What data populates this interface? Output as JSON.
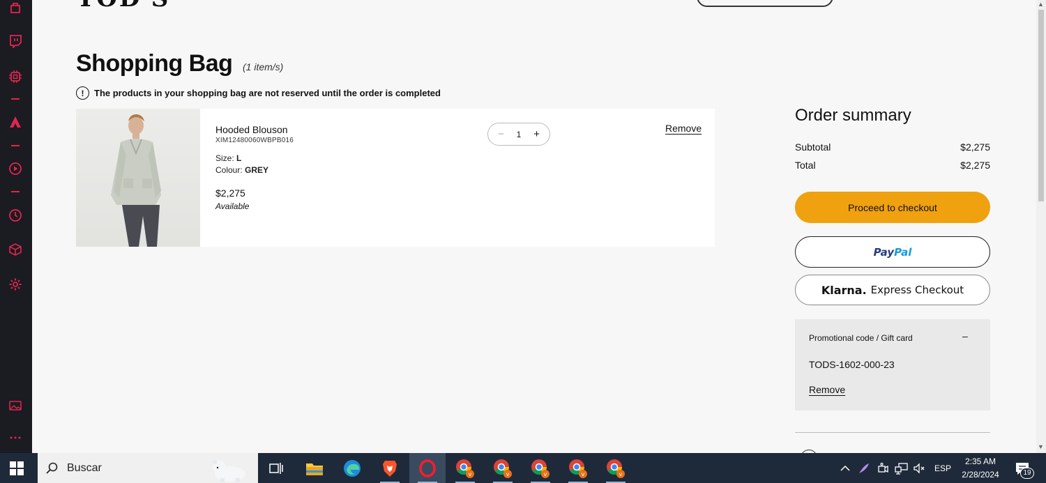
{
  "header": {
    "logo": "TOD'S"
  },
  "cart": {
    "title": "Shopping Bag",
    "count": "(1 item/s)",
    "notice": "The products in your shopping bag are not reserved until the order is completed",
    "item": {
      "name": "Hooded Blouson",
      "sku": "XIM12480060WBPB016",
      "size_label": "Size:",
      "size": "L",
      "colour_label": "Colour:",
      "colour": "GREY",
      "price": "$2,275",
      "availability": "Available",
      "quantity": "1",
      "minus": "−",
      "plus": "+",
      "remove": "Remove"
    }
  },
  "summary": {
    "title": "Order summary",
    "subtotal_label": "Subtotal",
    "subtotal": "$2,275",
    "total_label": "Total",
    "total": "$2,275",
    "checkout": "Proceed to checkout",
    "paypal_a": "Pay",
    "paypal_b": "Pal",
    "klarna_logo": "Klarna.",
    "klarna_text": "Express Checkout",
    "promo_label": "Promotional code / Gift card",
    "promo_toggle": "–",
    "promo_code": "TODS-1602-000-23",
    "promo_remove": "Remove"
  },
  "colors": {
    "checkout": "#f0a10f",
    "sidebar": "#1b1b22",
    "sidebar_icon": "#e0264e",
    "taskbar": "#1e2a3a"
  },
  "sidebar_icons": [
    "bag-icon",
    "twitch-icon",
    "chip-icon",
    "aria-icon",
    "play-icon",
    "history-icon",
    "box-icon",
    "settings-icon",
    "gallery-icon",
    "more-icon"
  ],
  "taskbar": {
    "search_text": "Buscar",
    "apps": [
      "task-view-icon",
      "file-explorer-icon",
      "edge-icon",
      "brave-icon",
      "opera-icon",
      "chrome-icon",
      "chrome-icon",
      "chrome-icon",
      "chrome-icon",
      "chrome-icon"
    ],
    "language": "ESP",
    "time": "2:35 AM",
    "date": "2/28/2024",
    "notifications": "19"
  }
}
